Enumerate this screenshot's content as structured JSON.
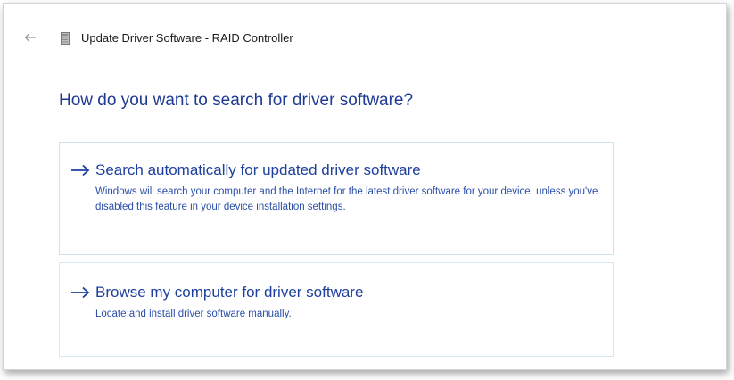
{
  "window": {
    "title": "Update Driver Software - RAID Controller"
  },
  "icons": {
    "back": "back-arrow-icon",
    "device": "device-icon",
    "option_arrow": "right-arrow-icon"
  },
  "main": {
    "question": "How do you want to search for driver software?",
    "options": [
      {
        "title": "Search automatically for updated driver software",
        "description": "Windows will search your computer and the Internet for the latest driver software for your device, unless you've disabled this feature in your device installation settings."
      },
      {
        "title": "Browse my computer for driver software",
        "description": "Locate and install driver software manually."
      }
    ]
  },
  "colors": {
    "heading": "#1f3a93",
    "link": "#1e3f9e",
    "description": "#2a4ea8",
    "option_border": "#d9e8ee"
  }
}
